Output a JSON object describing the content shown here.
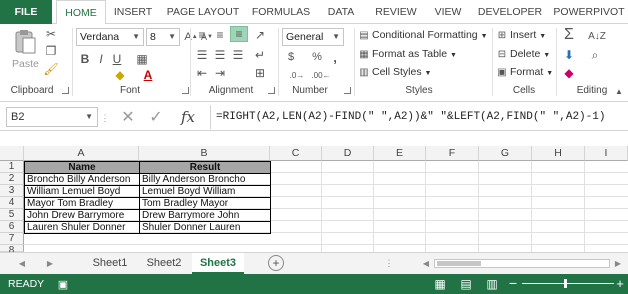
{
  "ribbon_tabs": [
    "FILE",
    "HOME",
    "INSERT",
    "PAGE LAYOUT",
    "FORMULAS",
    "DATA",
    "REVIEW",
    "VIEW",
    "DEVELOPER",
    "POWERPIVOT"
  ],
  "ribbon": {
    "clipboard": {
      "paste_label": "Paste",
      "group_label": "Clipboard"
    },
    "font": {
      "font_name": "Verdana",
      "font_size": "8",
      "bold": "B",
      "italic": "I",
      "underline": "U",
      "group_label": "Font"
    },
    "alignment": {
      "group_label": "Alignment"
    },
    "number": {
      "format": "General",
      "currency": "$",
      "percent": "%",
      "comma": ",",
      "group_label": "Number"
    },
    "styles": {
      "conditional": "Conditional Formatting",
      "format_table": "Format as Table",
      "cell_styles": "Cell Styles",
      "group_label": "Styles"
    },
    "cells": {
      "insert": "Insert",
      "delete": "Delete",
      "format": "Format",
      "group_label": "Cells"
    },
    "editing": {
      "group_label": "Editing"
    }
  },
  "formula_bar": {
    "name_box": "B2",
    "fx": "fx",
    "formula": "=RIGHT(A2,LEN(A2)-FIND(\" \",A2))&\" \"&LEFT(A2,FIND(\" \",A2)-1)"
  },
  "columns": [
    "A",
    "B",
    "C",
    "D",
    "E",
    "F",
    "G",
    "H",
    "I"
  ],
  "rows": [
    "1",
    "2",
    "3",
    "4",
    "5",
    "6",
    "7",
    "8"
  ],
  "table": {
    "headers": [
      "Name",
      "Result"
    ],
    "rows": [
      [
        "Broncho Billy Anderson",
        "Billy Anderson Broncho"
      ],
      [
        "William Lemuel Boyd",
        "Lemuel Boyd William"
      ],
      [
        "Mayor Tom Bradley",
        "Tom Bradley Mayor"
      ],
      [
        "John Drew Barrymore",
        "Drew Barrymore John"
      ],
      [
        "Lauren Shuler Donner",
        "Shuler Donner Lauren"
      ]
    ]
  },
  "sheets": [
    "Sheet1",
    "Sheet2",
    "Sheet3"
  ],
  "active_sheet": "Sheet3",
  "status": {
    "mode": "READY"
  },
  "colors": {
    "excel_green": "#217346",
    "header_fill": "#a6a6a6"
  }
}
